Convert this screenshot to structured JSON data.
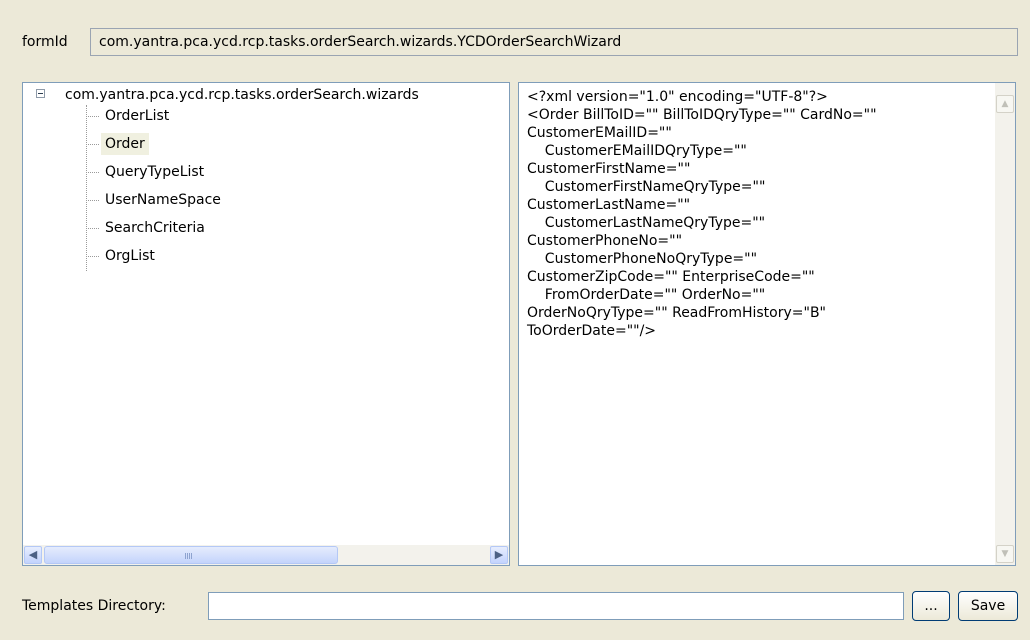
{
  "form": {
    "formid_label": "formId",
    "formid_value": "com.yantra.pca.ycd.rcp.tasks.orderSearch.wizards.YCDOrderSearchWizard"
  },
  "tree": {
    "root_label": "com.yantra.pca.ycd.rcp.tasks.orderSearch.wizards",
    "children": [
      "OrderList",
      "Order",
      "QueryTypeList",
      "UserNameSpace",
      "SearchCriteria",
      "OrgList"
    ],
    "selected": "Order",
    "hscroll_left_icon": "◀",
    "hscroll_right_icon": "▶"
  },
  "xml": {
    "content": "<?xml version=\"1.0\" encoding=\"UTF-8\"?>\n<Order BillToID=\"\" BillToIDQryType=\"\" CardNo=\"\"\nCustomerEMailID=\"\"\n    CustomerEMailIDQryType=\"\"\nCustomerFirstName=\"\"\n    CustomerFirstNameQryType=\"\"\nCustomerLastName=\"\"\n    CustomerLastNameQryType=\"\"\nCustomerPhoneNo=\"\"\n    CustomerPhoneNoQryType=\"\"\nCustomerZipCode=\"\" EnterpriseCode=\"\"\n    FromOrderDate=\"\" OrderNo=\"\"\nOrderNoQryType=\"\" ReadFromHistory=\"B\"\nToOrderDate=\"\"/>",
    "vscroll_up_icon": "▲",
    "vscroll_down_icon": "▼"
  },
  "templates": {
    "label": "Templates Directory:",
    "value": "",
    "browse_label": "...",
    "save_label": "Save"
  }
}
